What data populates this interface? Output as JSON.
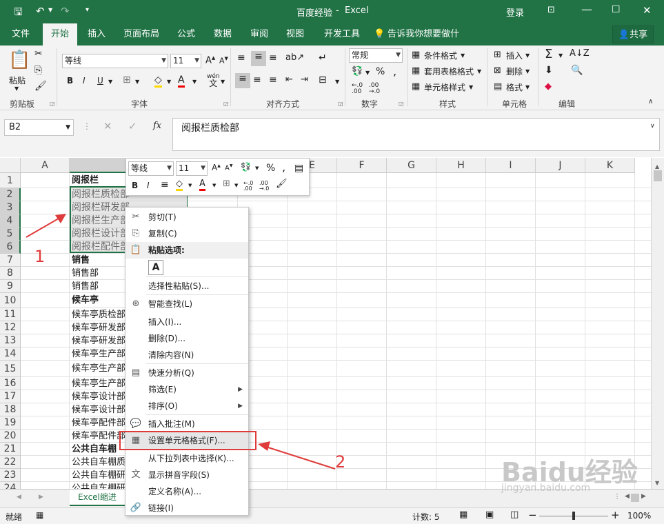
{
  "titlebar": {
    "doc_title": "百度经验",
    "app_name": "Excel",
    "separator": "-",
    "login": "登录"
  },
  "tabs": [
    "文件",
    "开始",
    "插入",
    "页面布局",
    "公式",
    "数据",
    "审阅",
    "视图",
    "开发工具"
  ],
  "tell_me": "告诉我你想要做什么",
  "share": "共享",
  "ribbon": {
    "paste": "粘贴",
    "font_name": "等线",
    "font_size": "11",
    "wen": "wén",
    "wen2": "文",
    "number_format": "常规",
    "cond_format": "条件格式",
    "table_format": "套用表格格式",
    "cell_style": "单元格样式",
    "insert": "插入",
    "delete": "删除",
    "format": "格式",
    "groups": [
      "剪贴板",
      "字体",
      "对齐方式",
      "数字",
      "样式",
      "单元格",
      "编辑"
    ]
  },
  "formula": {
    "name_box": "B2",
    "fx": "fx",
    "content": "阅报栏质检部"
  },
  "columns": [
    "A",
    "B",
    "C",
    "D",
    "E",
    "F",
    "G",
    "H",
    "I",
    "J",
    "K"
  ],
  "rows": [
    {
      "n": "1",
      "b": "阅报栏",
      "bold": true
    },
    {
      "n": "2",
      "b": "阅报栏质检部"
    },
    {
      "n": "3",
      "b": "阅报栏研发部"
    },
    {
      "n": "4",
      "b": "阅报栏生产部"
    },
    {
      "n": "5",
      "b": "阅报栏设计部"
    },
    {
      "n": "6",
      "b": "阅报栏配件部"
    },
    {
      "n": "7",
      "b": "销售",
      "bold": true
    },
    {
      "n": "8",
      "b": "销售部"
    },
    {
      "n": "9",
      "b": "销售部"
    },
    {
      "n": "10",
      "b": "候车亭",
      "bold": true
    },
    {
      "n": "11",
      "b": "候车亭质检部"
    },
    {
      "n": "12",
      "b": "候车亭研发部"
    },
    {
      "n": "13",
      "b": "候车亭研发部"
    },
    {
      "n": "14",
      "b": "候车亭生产部"
    },
    {
      "n": "15",
      "b": "候车亭生产部"
    },
    {
      "n": "16",
      "b": "候车亭生产部"
    },
    {
      "n": "17",
      "b": "候车亭设计部"
    },
    {
      "n": "18",
      "b": "候车亭设计部"
    },
    {
      "n": "19",
      "b": "候车亭配件部"
    },
    {
      "n": "20",
      "b": "候车亭配件部"
    },
    {
      "n": "21",
      "b": "公共自车棚",
      "bold": true
    },
    {
      "n": "22",
      "b": "公共自车棚质检部"
    },
    {
      "n": "23",
      "b": "公共自车棚研发部"
    },
    {
      "n": "24",
      "b": "公共自车棚研发部"
    }
  ],
  "minibar": {
    "font": "等线",
    "size": "11",
    "percent": "%",
    "comma": ","
  },
  "context_menu": {
    "items": [
      {
        "label": "剪切(T)",
        "icon": "scissors-icon",
        "glyph": "✂"
      },
      {
        "label": "复制(C)",
        "icon": "copy-icon",
        "glyph": "⎘"
      },
      {
        "label": "粘贴选项:",
        "icon": "paste-icon",
        "glyph": "📋",
        "header": true
      },
      {
        "label": "选择性粘贴(S)...",
        "icon": "",
        "glyph": ""
      },
      {
        "label": "智能查找(L)",
        "icon": "smart-lookup-icon",
        "glyph": "⊛"
      },
      {
        "label": "插入(I)...",
        "icon": "",
        "glyph": ""
      },
      {
        "label": "删除(D)...",
        "icon": "",
        "glyph": ""
      },
      {
        "label": "清除内容(N)",
        "icon": "",
        "glyph": ""
      },
      {
        "label": "快速分析(Q)",
        "icon": "quick-analysis-icon",
        "glyph": "▤"
      },
      {
        "label": "筛选(E)",
        "icon": "",
        "glyph": "",
        "submenu": true
      },
      {
        "label": "排序(O)",
        "icon": "",
        "glyph": "",
        "submenu": true
      },
      {
        "label": "插入批注(M)",
        "icon": "comment-icon",
        "glyph": "💬"
      },
      {
        "label": "设置单元格格式(F)...",
        "icon": "format-cells-icon",
        "glyph": "▦"
      },
      {
        "label": "从下拉列表中选择(K)...",
        "icon": "",
        "glyph": ""
      },
      {
        "label": "显示拼音字段(S)",
        "icon": "pinyin-icon",
        "glyph": "文"
      },
      {
        "label": "定义名称(A)...",
        "icon": "",
        "glyph": ""
      },
      {
        "label": "链接(I)",
        "icon": "link-icon",
        "glyph": "🔗"
      }
    ],
    "paste_glyph": "A"
  },
  "sheet": {
    "tab_name": "Excel缩进"
  },
  "status": {
    "mode": "就绪",
    "count": "计数: 5",
    "zoom": "100%"
  },
  "annotations": {
    "one": "1",
    "two": "2"
  },
  "watermark": {
    "brand": "Baidu经验",
    "url": "jingyan.baidu.com"
  },
  "colors": {
    "excel_green": "#217346",
    "annotation_red": "#e03b3b"
  }
}
